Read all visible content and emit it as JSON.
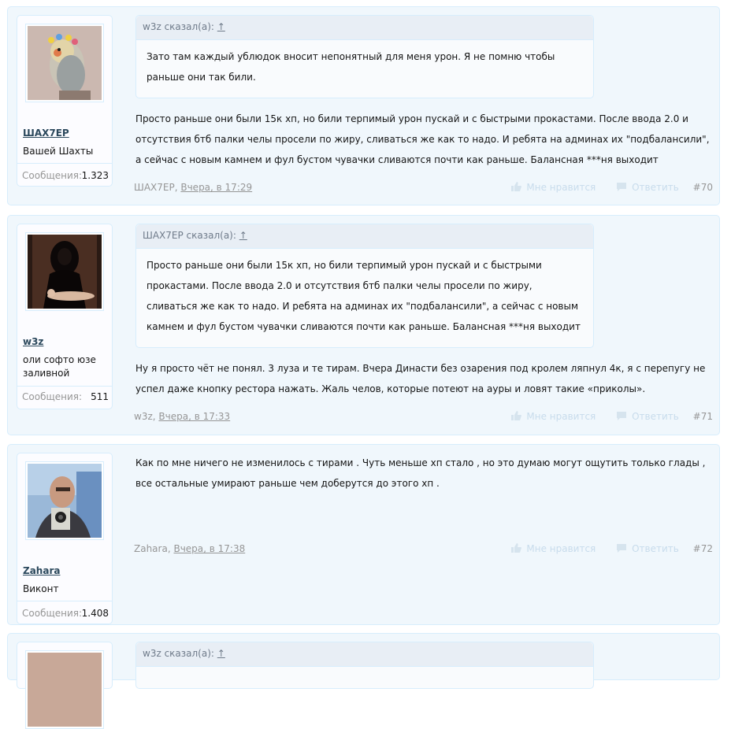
{
  "posts": [
    {
      "username": "ШАХ7ЕР",
      "user_title": "Вашей Шахты",
      "messages_label": "Сообщения:",
      "messages_count": "1.323",
      "quote_author": "w3z сказал(а):",
      "quote_link": "↑",
      "quote_text": "Зато там каждый ублюдок вносит непонятный для меня урон. Я не помню чтобы раньше они так били.",
      "text": "Просто раньше они были 15к хп, но били терпимый урон пускай и с быстрыми прокастами. После ввода 2.0 и отсутствия бтб палки челы просели по жиру, сливаться же как то надо. И ребята на админах их \"подбалансили\", а сейчас с новым камнем и фул бустом чувачки сливаются почти как раньше. Балансная ***ня выходит",
      "meta_author": "ШАХ7ЕР,",
      "meta_date": "Вчера, в 17:29",
      "like_label": "Мне нравится",
      "reply_label": "Ответить",
      "post_number": "#70"
    },
    {
      "username": "w3z",
      "user_title": "оли софто юзе заливной",
      "messages_label": "Сообщения:",
      "messages_count": "511",
      "quote_author": "ШАХ7ЕР сказал(а):",
      "quote_link": "↑",
      "quote_text": "Просто раньше они были 15к хп, но били терпимый урон пускай и с быстрыми прокастами. После ввода 2.0 и отсутствия бтб палки челы просели по жиру, сливаться же как то надо. И ребята на админах их \"подбалансили\", а сейчас с новым камнем и фул бустом чувачки сливаются почти как раньше. Балансная ***ня выходит",
      "text": "Ну я просто чёт не понял. 3 луза и те тирам. Вчера Династи без озарения под кролем ляпнул 4к, я с перепугу не успел даже кнопку рестора нажать. Жаль челов, которые потеют на ауры и ловят такие «приколы».",
      "meta_author": "w3z,",
      "meta_date": "Вчера, в 17:33",
      "like_label": "Мне нравится",
      "reply_label": "Ответить",
      "post_number": "#71"
    },
    {
      "username": "Zahara",
      "user_title": "Виконт",
      "messages_label": "Сообщения:",
      "messages_count": "1.408",
      "text": "Как по мне ничего не изменилось с тирами . Чуть меньше хп стало , но это думаю могут ощутить только глады , все остальные умирают раньше чем доберутся до этого хп .",
      "meta_author": "Zahara,",
      "meta_date": "Вчера, в 17:38",
      "like_label": "Мне нравится",
      "reply_label": "Ответить",
      "post_number": "#72"
    },
    {
      "quote_author": "w3z сказал(а):",
      "quote_link": "↑"
    }
  ]
}
